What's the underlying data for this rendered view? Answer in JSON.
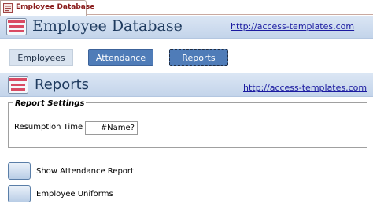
{
  "document_tab": {
    "label": "Employee Database"
  },
  "header": {
    "title": "Employee Database",
    "link": "http://access-templates.com"
  },
  "nav": [
    {
      "label": "Employees"
    },
    {
      "label": "Attendance"
    },
    {
      "label": "Reports"
    }
  ],
  "section": {
    "title": "Reports",
    "link": "http://access-templates.com"
  },
  "report_settings": {
    "legend": "Report Settings",
    "resumption_time_label": "Resumption Time",
    "resumption_time_value": "#Name?"
  },
  "reports": [
    {
      "label": "Show Attendance Report"
    },
    {
      "label": "Employee Uniforms"
    }
  ],
  "colors": {
    "nav_active": "#4f7cb8",
    "nav_inactive": "#d9e3ef",
    "link": "#1a1aa0",
    "title": "#1f3b5f"
  },
  "icons": {
    "tab": "form-icon",
    "header": "form-icon",
    "section": "form-icon"
  }
}
